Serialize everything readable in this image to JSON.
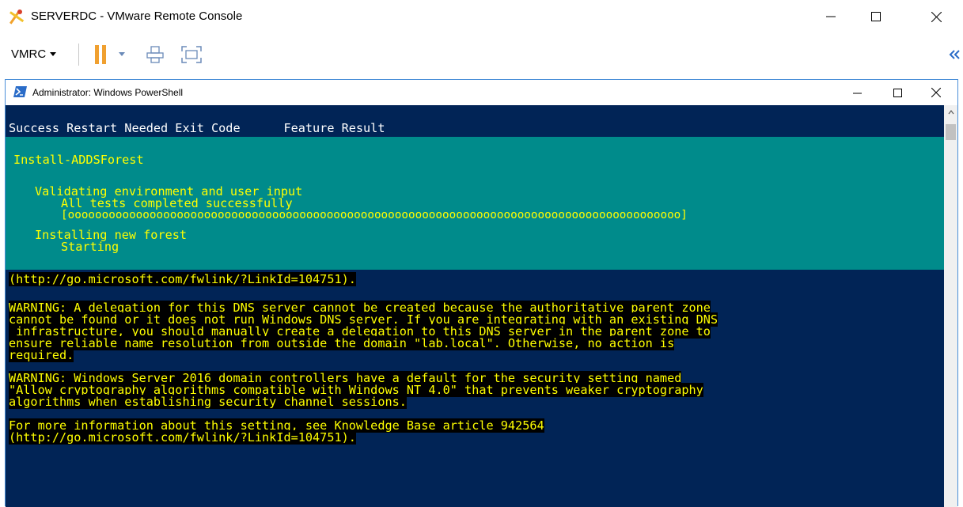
{
  "app": {
    "title": "SERVERDC - VMware Remote Console",
    "icons": {
      "app": "vmware-remote-console-icon",
      "minimize": "minimize-icon",
      "maximize": "maximize-icon",
      "close": "close-icon"
    }
  },
  "toolbar": {
    "menu_label": "VMRC",
    "items": [
      "pause-icon",
      "dropdown-arrow-icon",
      "send-ctrl-alt-del-icon",
      "fullscreen-icon",
      "collapse-double-chevron-icon"
    ],
    "colors": {
      "pause": "#f0a030",
      "icon": "#6a8ab8"
    }
  },
  "powershell": {
    "title": "Administrator: Windows PowerShell",
    "colors": {
      "background": "#012456",
      "progress_background": "#008b8b",
      "progress_text": "#ffff00",
      "warning_background": "#000000",
      "warning_text": "#ffff00",
      "text": "#ffffff"
    },
    "header_line": "Success Restart Needed Exit Code      Feature Result",
    "progress": {
      "activity": "Install-ADDSForest",
      "line1": "Validating environment and user input",
      "line2": "All tests completed successfully",
      "bar": "[oooooooooooooooooooooooooooooooooooooooooooooooooooooooooooooooooooooooooooooooooooooooooo]",
      "line3": "Installing new forest",
      "line4": "Starting"
    },
    "lines": {
      "link_line": "(http://go.microsoft.com/fwlink/?LinkId=104751).",
      "warning1": [
        "WARNING: A delegation for this DNS server cannot be created because the authoritative parent zone",
        "cannot be found or it does not run Windows DNS server. If you are integrating with an existing DNS",
        " infrastructure, you should manually create a delegation to this DNS server in the parent zone to",
        "ensure reliable name resolution from outside the domain \"lab.local\". Otherwise, no action is",
        "required."
      ],
      "warning2": [
        "WARNING: Windows Server 2016 domain controllers have a default for the security setting named",
        "\"Allow cryptography algorithms compatible with Windows NT 4.0\" that prevents weaker cryptography",
        "algorithms when establishing security channel sessions."
      ],
      "info": [
        "For more information about this setting, see Knowledge Base article 942564",
        "(http://go.microsoft.com/fwlink/?LinkId=104751)."
      ]
    }
  }
}
